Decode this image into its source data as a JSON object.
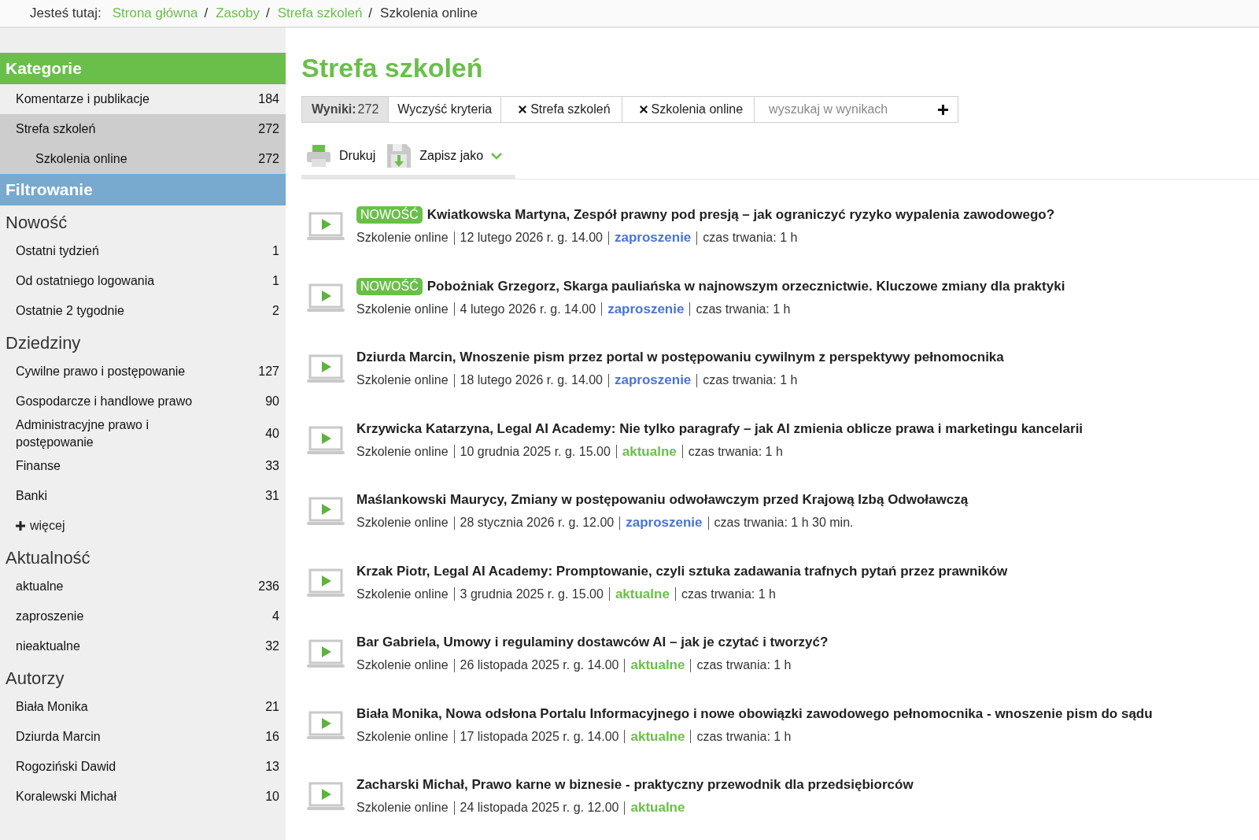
{
  "breadcrumb": {
    "label": "Jesteś tutaj:",
    "links": [
      {
        "label": "Strona główna",
        "separator": "/"
      },
      {
        "label": "Zasoby",
        "separator": "/"
      },
      {
        "label": "Strefa szkoleń",
        "separator": "/"
      }
    ],
    "current": "Szkolenia online"
  },
  "sidebar": {
    "categories_title": "Kategorie",
    "categories": [
      {
        "label": "Komentarze i publikacje",
        "count": "184",
        "selected": false
      },
      {
        "label": "Strefa szkoleń",
        "count": "272",
        "selected": true,
        "children": [
          {
            "label": "Szkolenia online",
            "count": "272",
            "selected": true
          }
        ]
      }
    ],
    "filter_title": "Filtrowanie",
    "groups": [
      {
        "title": "Nowość",
        "items": [
          {
            "label": "Ostatni tydzień",
            "count": "1"
          },
          {
            "label": "Od ostatniego logowania",
            "count": "1"
          },
          {
            "label": "Ostatnie 2 tygodnie",
            "count": "2"
          }
        ]
      },
      {
        "title": "Dziedziny",
        "items": [
          {
            "label": "Cywilne prawo i postępowanie",
            "count": "127"
          },
          {
            "label": "Gospodarcze i handlowe prawo",
            "count": "90"
          },
          {
            "label": "Administracyjne prawo i postępowanie",
            "count": "40"
          },
          {
            "label": "Finanse",
            "count": "33"
          },
          {
            "label": "Banki",
            "count": "31"
          }
        ],
        "more": "więcej"
      },
      {
        "title": "Aktualność",
        "items": [
          {
            "label": "aktualne",
            "count": "236"
          },
          {
            "label": "zaproszenie",
            "count": "4"
          },
          {
            "label": "nieaktualne",
            "count": "32"
          }
        ]
      },
      {
        "title": "Autorzy",
        "items": [
          {
            "label": "Biała Monika",
            "count": "21"
          },
          {
            "label": "Dziurda Marcin",
            "count": "16"
          },
          {
            "label": "Rogoziński Dawid",
            "count": "13"
          },
          {
            "label": "Koralewski Michał",
            "count": "10"
          }
        ]
      }
    ]
  },
  "main": {
    "title": "Strefa szkoleń",
    "criteria": {
      "results_label": "Wyniki:",
      "results_count": "272",
      "clear": "Wyczyść kryteria",
      "filters": [
        "Strefa szkoleń",
        "Szkolenia online"
      ],
      "search_placeholder": "wyszukaj w wynikach"
    },
    "actions": {
      "print": "Drukuj",
      "save": "Zapisz jako"
    },
    "results": [
      {
        "new_badge": "NOWOŚĆ",
        "title": "Kwiatkowska Martyna, Zespół prawny pod presją – jak ograniczyć ryzyko wypalenia zawodowego?",
        "type": "Szkolenie online",
        "date": "12 lutego 2026 r. g. 14.00",
        "status": {
          "label": "zaproszenie",
          "color": "#4a73d9"
        },
        "duration": "czas trwania: 1 h"
      },
      {
        "new_badge": "NOWOŚĆ",
        "title": "Pobożniak Grzegorz, Skarga pauliańska w najnowszym orzecznictwie. Kluczowe zmiany dla praktyki",
        "type": "Szkolenie online",
        "date": "4 lutego 2026 r. g. 14.00",
        "status": {
          "label": "zaproszenie",
          "color": "#4a73d9"
        },
        "duration": "czas trwania: 1 h"
      },
      {
        "title": "Dziurda Marcin, Wnoszenie pism przez portal w postępowaniu cywilnym z perspektywy pełnomocnika",
        "type": "Szkolenie online",
        "date": "18 lutego 2026 r. g. 14.00",
        "status": {
          "label": "zaproszenie",
          "color": "#4a73d9"
        },
        "duration": "czas trwania: 1 h"
      },
      {
        "title": "Krzywicka Katarzyna, Legal AI Academy: Nie tylko paragrafy – jak AI zmienia oblicze prawa i marketingu kancelarii",
        "type": "Szkolenie online",
        "date": "10 grudnia 2025 r. g. 15.00",
        "status": {
          "label": "aktualne",
          "color": "#6abf4b"
        },
        "duration": "czas trwania: 1 h"
      },
      {
        "title": "Maślankowski Maurycy, Zmiany w postępowaniu odwoławczym przed Krajową Izbą Odwoławczą",
        "type": "Szkolenie online",
        "date": "28 stycznia 2026 r. g. 12.00",
        "status": {
          "label": "zaproszenie",
          "color": "#4a73d9"
        },
        "duration": "czas trwania: 1 h 30 min."
      },
      {
        "title": "Krzak Piotr, Legal AI Academy: Promptowanie, czyli sztuka zadawania trafnych pytań przez prawników",
        "type": "Szkolenie online",
        "date": "3 grudnia 2025 r. g. 15.00",
        "status": {
          "label": "aktualne",
          "color": "#6abf4b"
        },
        "duration": "czas trwania: 1 h"
      },
      {
        "title": "Bar Gabriela, Umowy i regulaminy dostawców AI – jak je czytać i tworzyć?",
        "type": "Szkolenie online",
        "date": "26 listopada 2025 r. g. 14.00",
        "status": {
          "label": "aktualne",
          "color": "#6abf4b"
        },
        "duration": "czas trwania: 1 h"
      },
      {
        "title": "Biała Monika, Nowa odsłona Portalu Informacyjnego i nowe obowiązki zawodowego pełnomocnika - wnoszenie pism do sądu",
        "type": "Szkolenie online",
        "date": "17 listopada 2025 r. g. 14.00",
        "status": {
          "label": "aktualne",
          "color": "#6abf4b"
        },
        "duration": "czas trwania: 1 h"
      },
      {
        "title": "Zacharski Michał, Prawo karne w biznesie - praktyczny przewodnik dla przedsiębiorców",
        "type": "Szkolenie online",
        "date": "24 listopada 2025 r. g. 12.00",
        "status": {
          "label": "aktualne",
          "color": "#6abf4b"
        }
      }
    ]
  }
}
